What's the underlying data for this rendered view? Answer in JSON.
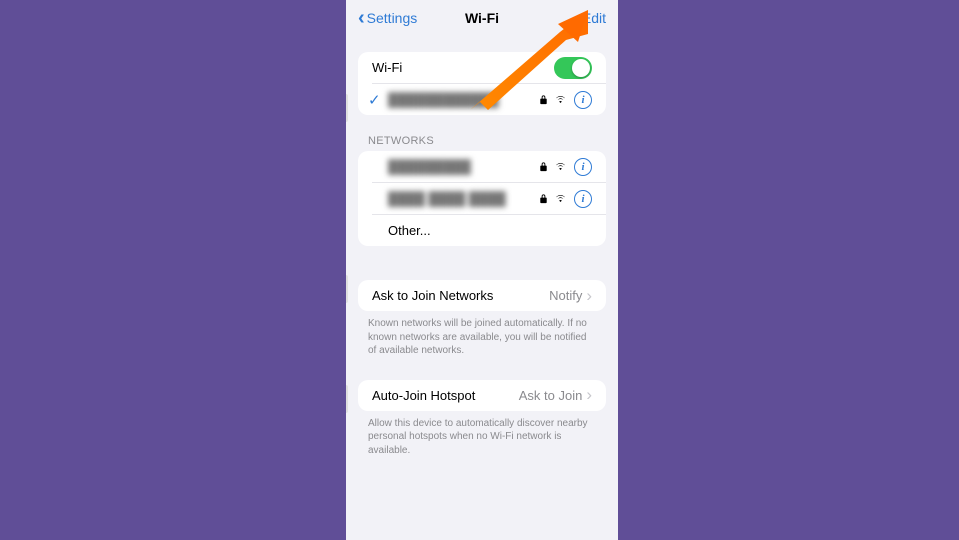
{
  "nav": {
    "back": "Settings",
    "title": "Wi-Fi",
    "edit": "Edit"
  },
  "wifi": {
    "label": "Wi-Fi",
    "connected_name": "████████████",
    "toggle_on": true
  },
  "networks_header": "NETWORKS",
  "networks": [
    {
      "name": "█████████"
    },
    {
      "name": "████  ████ ████"
    }
  ],
  "other_label": "Other...",
  "ask_join": {
    "label": "Ask to Join Networks",
    "value": "Notify",
    "footer": "Known networks will be joined automatically. If no known networks are available, you will be notified of available networks."
  },
  "auto_hotspot": {
    "label": "Auto-Join Hotspot",
    "value": "Ask to Join",
    "footer": "Allow this device to automatically discover nearby personal hotspots when no Wi-Fi network is available."
  },
  "icons": {
    "chevron_left": "‹",
    "check": "✓",
    "info": "i",
    "chevron_right": "›"
  }
}
